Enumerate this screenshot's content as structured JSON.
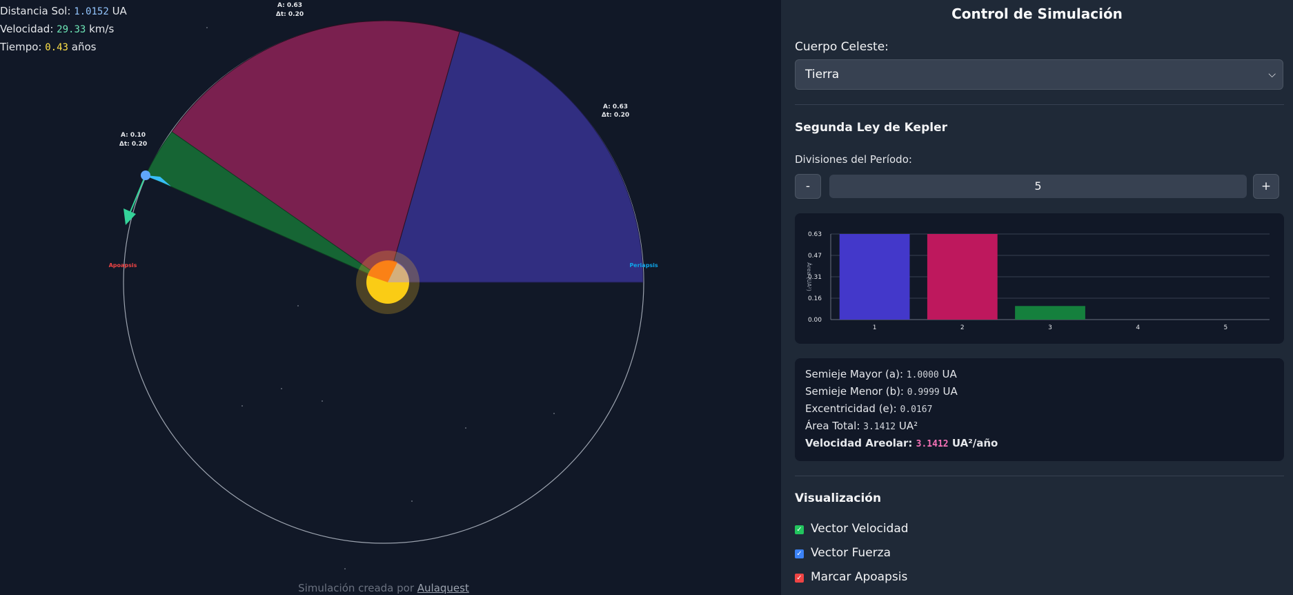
{
  "hud": {
    "distance_label": "Distancia Sol:",
    "distance_value": "1.0152",
    "distance_unit": "UA",
    "velocity_label": "Velocidad:",
    "velocity_value": "29.33",
    "velocity_unit": "km/s",
    "time_label": "Tiempo:",
    "time_value": "0.43",
    "time_unit": "años"
  },
  "orbit": {
    "apoapsis_label": "Apoapsis",
    "periapsis_label": "Periapsis",
    "sectors": [
      {
        "area_label": "A: 0.63",
        "dt_label": "Δt: 0.20",
        "color": "#312e81"
      },
      {
        "area_label": "A: 0.63",
        "dt_label": "Δt: 0.20",
        "color": "#7a204f"
      },
      {
        "area_label": "A: 0.10",
        "dt_label": "Δt: 0.20",
        "color": "#166534"
      }
    ]
  },
  "credit": {
    "prefix": "Simulación creada por",
    "link": "Aulaquest"
  },
  "panel": {
    "title": "Control de Simulación",
    "body_label": "Cuerpo Celeste:",
    "body_selected": "Tierra",
    "kepler_heading": "Segunda Ley de Kepler",
    "divisions_label": "Divisiones del Período:",
    "minus_label": "-",
    "plus_label": "+",
    "divisions_value": "5",
    "info": {
      "semi_major_label": "Semieje Mayor (a):",
      "semi_major_value": "1.0000",
      "semi_major_unit": "UA",
      "semi_minor_label": "Semieje Menor (b):",
      "semi_minor_value": "0.9999",
      "semi_minor_unit": "UA",
      "ecc_label": "Excentricidad (e):",
      "ecc_value": "0.0167",
      "area_label": "Área Total:",
      "area_value": "3.1412",
      "area_unit": "UA²",
      "areal_label": "Velocidad Areolar:",
      "areal_value": "3.1412",
      "areal_unit": "UA²/año"
    },
    "viz_heading": "Visualización",
    "checkboxes": [
      {
        "label": "Vector Velocidad",
        "checked": true,
        "color": "#22c55e"
      },
      {
        "label": "Vector Fuerza",
        "checked": true,
        "color": "#3b82f6"
      },
      {
        "label": "Marcar Apoapsis",
        "checked": true,
        "color": "#ef4444"
      }
    ]
  },
  "chart_data": {
    "type": "bar",
    "categories": [
      "1",
      "2",
      "3",
      "4",
      "5"
    ],
    "values": [
      0.63,
      0.63,
      0.1,
      0,
      0
    ],
    "colors": [
      "#4338ca",
      "#be185d",
      "#15803d",
      "#475569",
      "#475569"
    ],
    "yticks": [
      "0.00",
      "0.16",
      "0.31",
      "0.47",
      "0.63"
    ],
    "ylim": [
      0,
      0.63
    ],
    "ylabel": "Área (UA²)",
    "grid": true
  }
}
